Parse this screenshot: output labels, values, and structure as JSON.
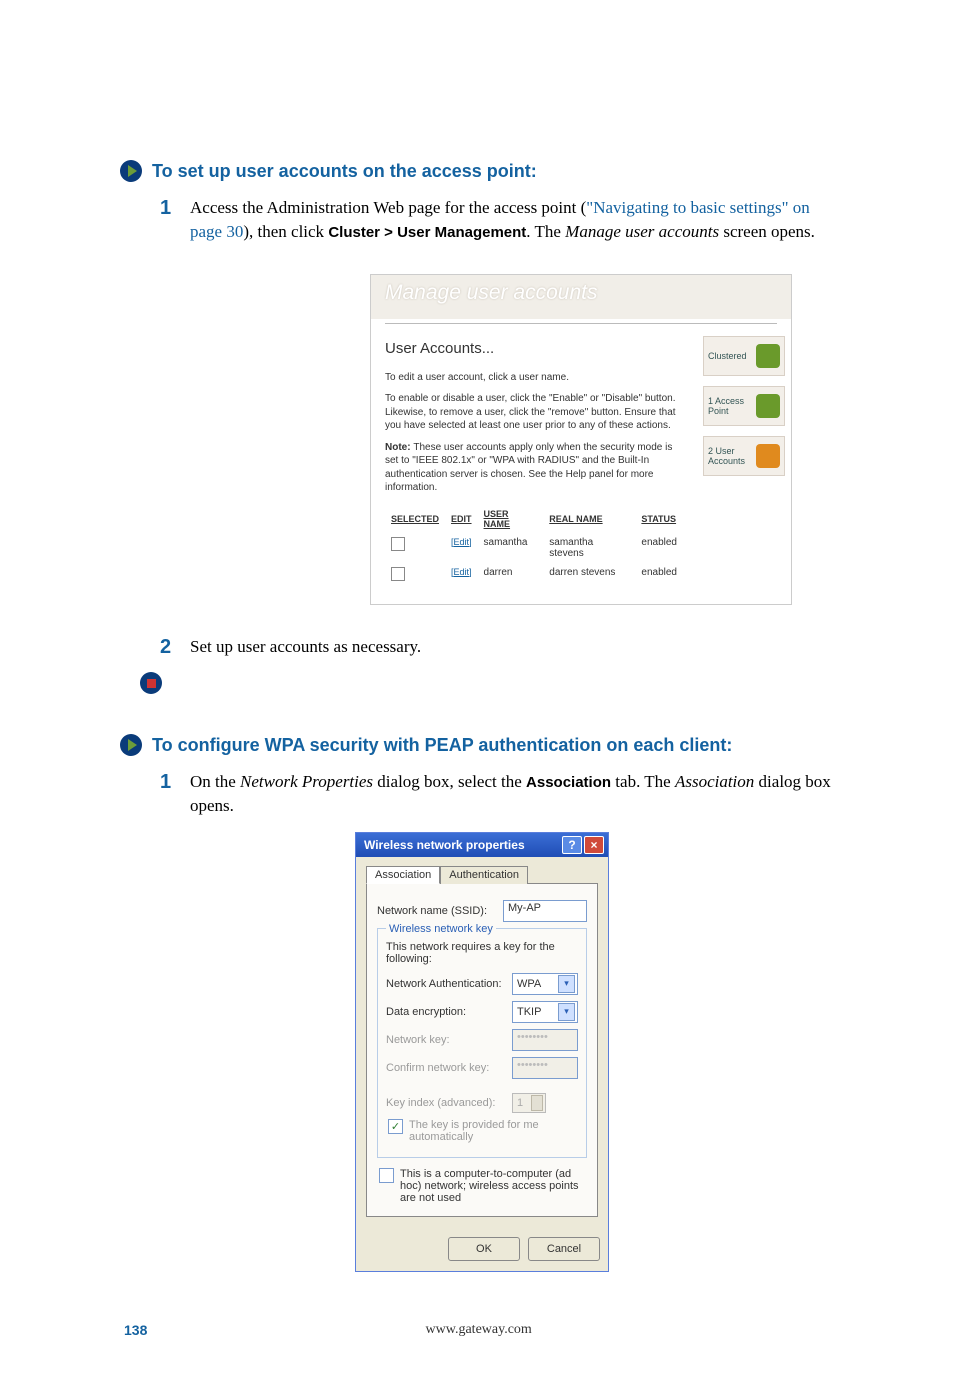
{
  "section1": {
    "title": "To set up user accounts on the access point:",
    "step1_a": "Access the Administration Web page for the access point (",
    "step1_link": "\"Navigating to basic settings\" on page 30",
    "step1_b": "), then click ",
    "step1_bold": "Cluster > User Management",
    "step1_c": ". The ",
    "step1_italic": "Manage user accounts",
    "step1_d": " screen opens.",
    "step2": "Set up user accounts as necessary."
  },
  "shot1": {
    "title": "Manage user accounts",
    "heading": "User Accounts...",
    "p1": "To edit a user account, click a user name.",
    "p2": "To enable or disable a user, click the \"Enable\" or \"Disable\" button. Likewise, to remove a user, click the \"remove\" button. Ensure that you have selected at least one user prior to any of these actions.",
    "p3_a": "Note: ",
    "p3_b": "These user accounts apply only when the security mode is set to \"IEEE 802.1x\" or \"WPA with RADIUS\" and the Built-In authentication server is chosen. See the Help panel for more information.",
    "side1": "Clustered",
    "side2a": "1 Access",
    "side2b": "Point",
    "side3a": "2 User",
    "side3b": "Accounts",
    "th_selected": "Selected",
    "th_edit": "Edit",
    "th_user": "User Name",
    "th_real": "Real Name",
    "th_status": "Status",
    "edit": "[Edit]",
    "rows": [
      {
        "user": "samantha",
        "real": "samantha stevens",
        "status": "enabled"
      },
      {
        "user": "darren",
        "real": "darren stevens",
        "status": "enabled"
      }
    ]
  },
  "section2": {
    "title": "To configure WPA security with PEAP authentication on each client:",
    "step1_a": "On the ",
    "step1_i1": "Network Properties",
    "step1_b": " dialog box, select the ",
    "step1_bold": "Association",
    "step1_c": " tab. The ",
    "step1_i2": "Association",
    "step1_d": " dialog box opens."
  },
  "shot2": {
    "title": "Wireless network properties",
    "tab_assoc": "Association",
    "tab_auth": "Authentication",
    "ssid_label": "Network name (SSID):",
    "ssid_value": "My-AP",
    "legend": "Wireless network key",
    "legend_sub": "This network requires a key for the following:",
    "auth_label": "Network Authentication:",
    "auth_value": "WPA",
    "enc_label": "Data encryption:",
    "enc_value": "TKIP",
    "key_label": "Network key:",
    "key_value": "••••••••",
    "ckey_label": "Confirm network key:",
    "ckey_value": "••••••••",
    "idx_label": "Key index (advanced):",
    "idx_value": "1",
    "auto_label": "The key is provided for me automatically",
    "adhoc_label": "This is a computer-to-computer (ad hoc) network; wireless access points are not used",
    "ok": "OK",
    "cancel": "Cancel"
  },
  "footer": {
    "page": "138",
    "url": "www.gateway.com"
  }
}
